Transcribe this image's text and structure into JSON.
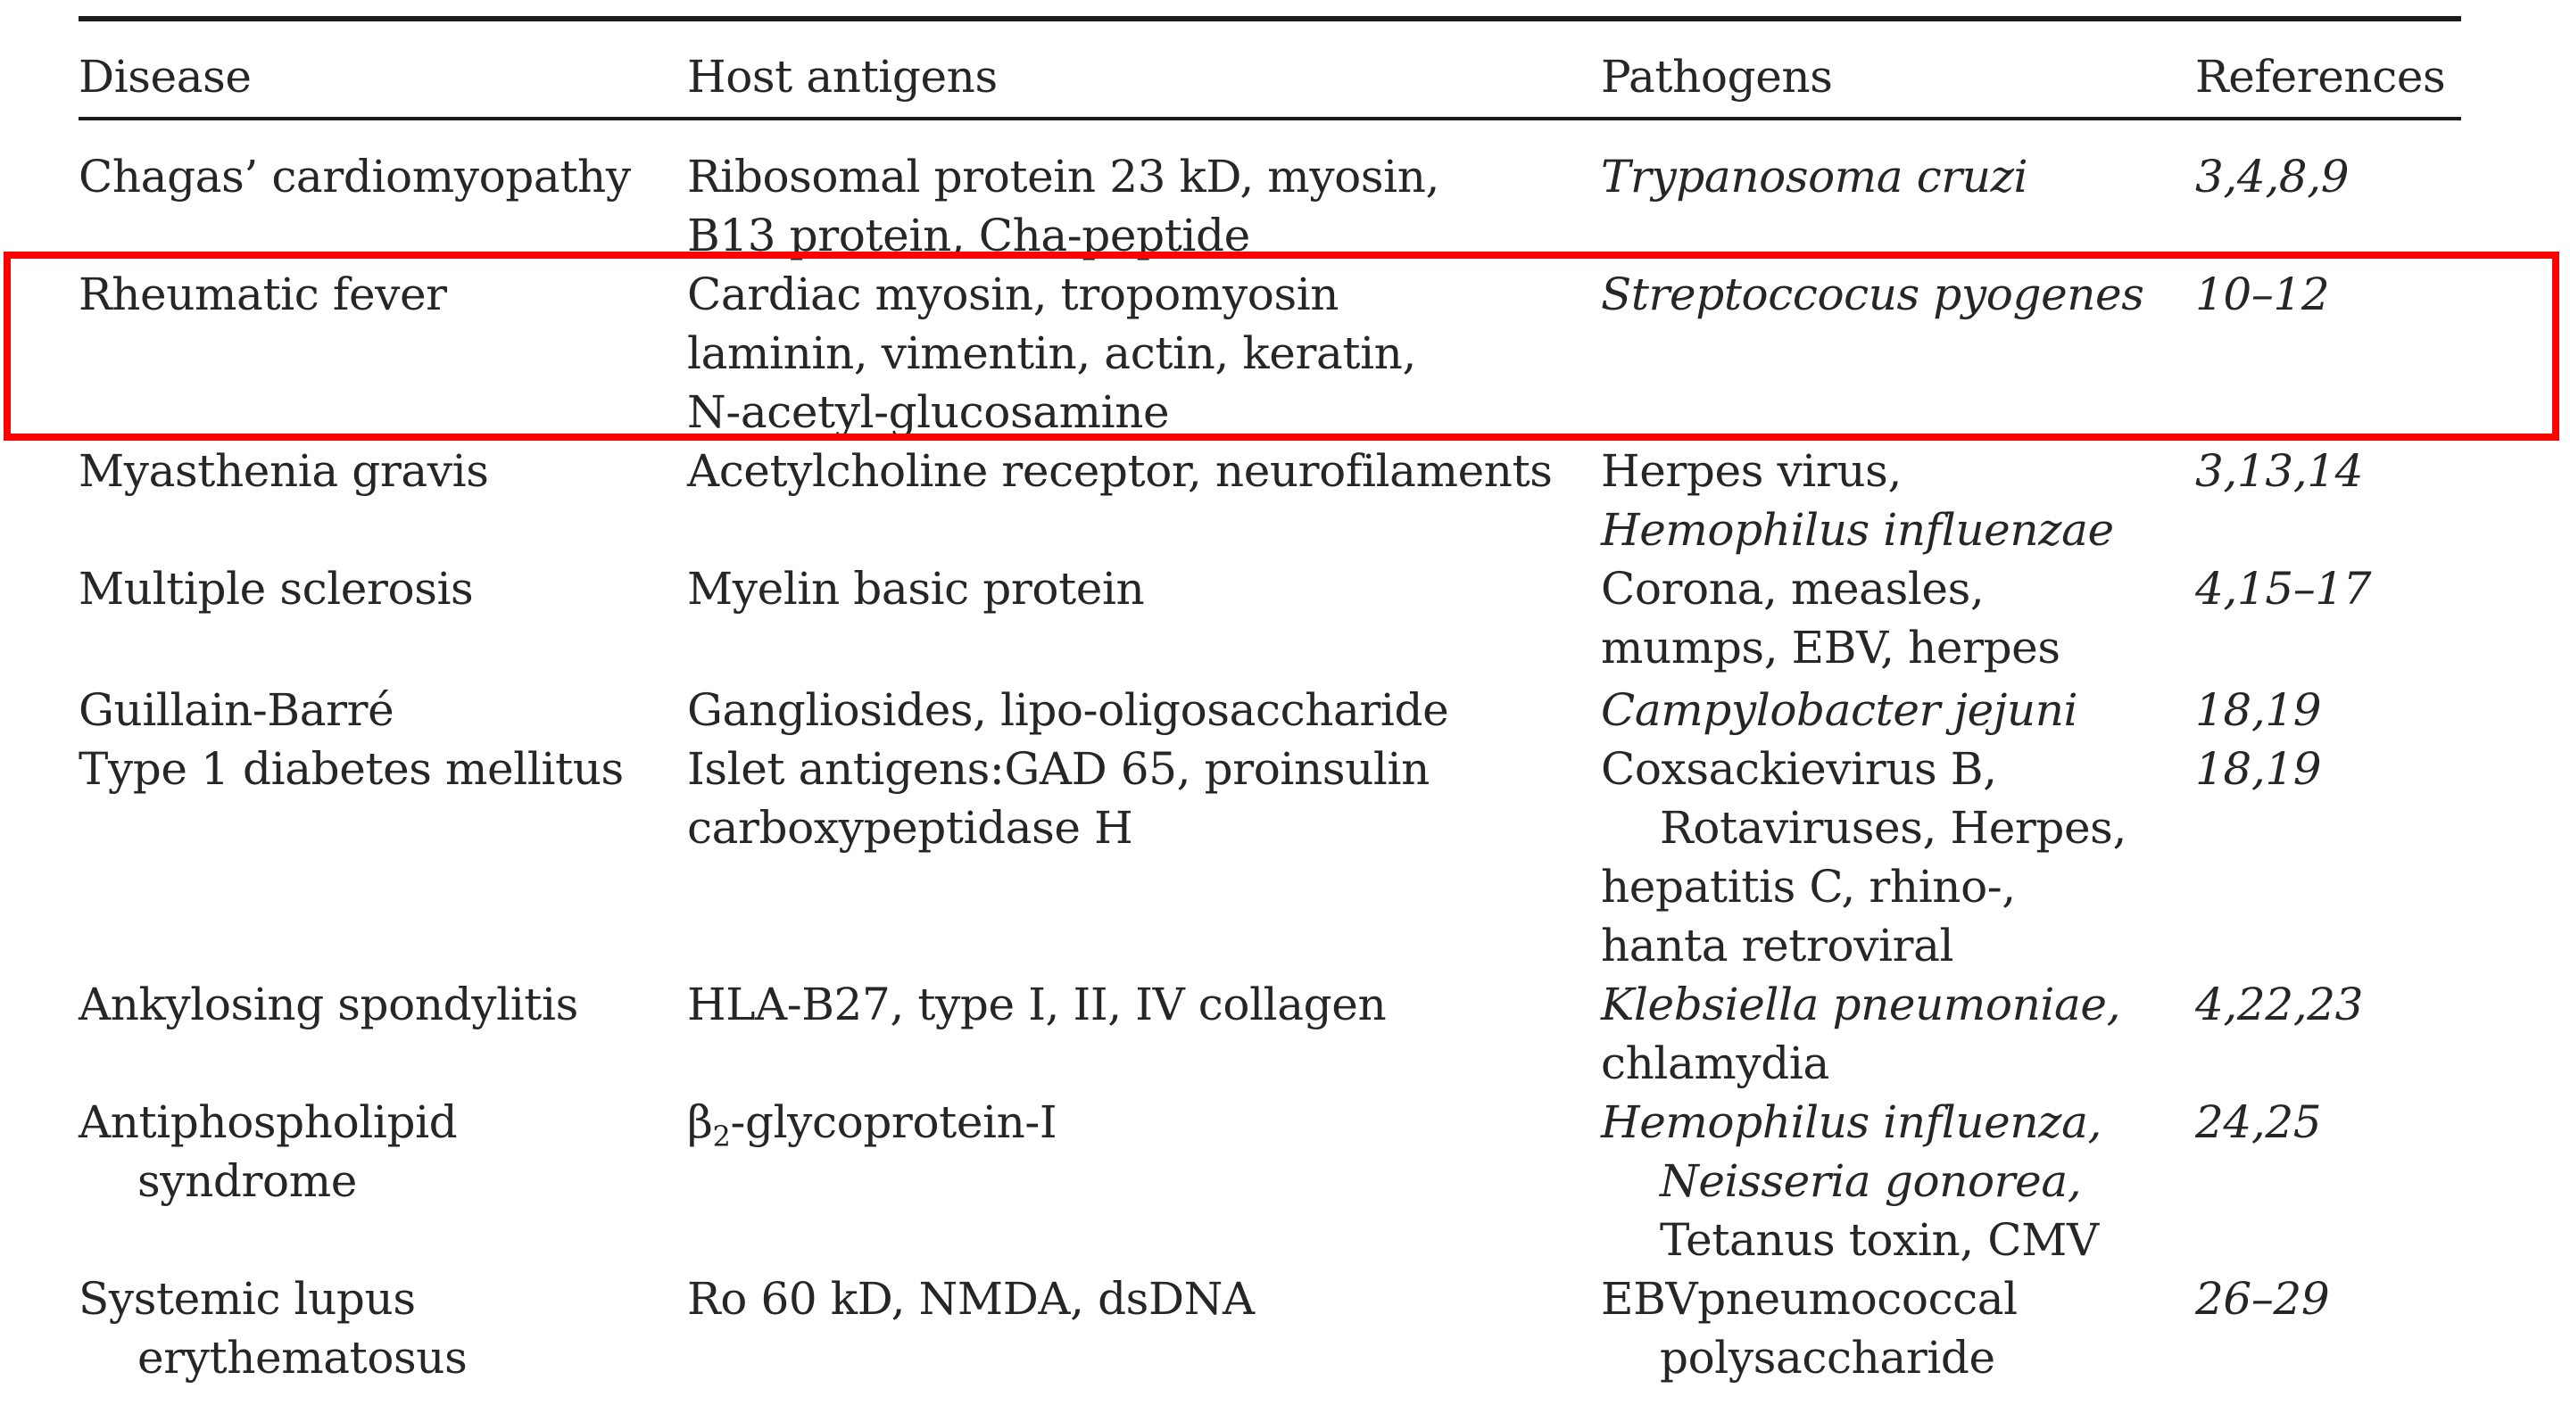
{
  "table": {
    "headers": {
      "disease": "Disease",
      "antigens": "Host antigens",
      "pathogens": "Pathogens",
      "refs": "References"
    },
    "rows": [
      {
        "disease": [
          "Chagas’ cardiomyopathy"
        ],
        "antigens": [
          "Ribosomal protein 23 kD, myosin,",
          "B13 protein, Cha-peptide"
        ],
        "pathogens": [
          "Trypanosoma cruzi"
        ],
        "refs": "3,4,8,9"
      },
      {
        "disease": [
          "Rheumatic fever"
        ],
        "antigens": [
          "Cardiac myosin, tropomyosin",
          "laminin, vimentin, actin, keratin,",
          "N-acetyl-glucosamine"
        ],
        "pathogens": [
          "Streptoccocus pyogenes"
        ],
        "refs": "10–12"
      },
      {
        "disease": [
          "Myasthenia gravis"
        ],
        "antigens": [
          "Acetylcholine receptor, neurofilaments"
        ],
        "pathogens": [
          "Herpes virus,",
          "Hemophilus influenzae"
        ],
        "refs": "3,13,14"
      },
      {
        "disease": [
          "Multiple sclerosis"
        ],
        "antigens": [
          "Myelin basic protein"
        ],
        "pathogens": [
          "Corona, measles,",
          "mumps, EBV, herpes"
        ],
        "refs": "4,15–17"
      },
      {
        "disease": [
          "Guillain-Barré"
        ],
        "antigens": [
          "Gangliosides, lipo-oligosaccharide"
        ],
        "pathogens": [
          "Campylobacter jejuni"
        ],
        "refs": "18,19"
      },
      {
        "disease": [
          "Type 1 diabetes mellitus"
        ],
        "antigens": [
          "Islet antigens:GAD 65, proinsulin",
          "carboxypeptidase H"
        ],
        "pathogens": [
          "Coxsackievirus B,",
          "Rotaviruses, Herpes,",
          "hepatitis C, rhino-,",
          "hanta retroviral"
        ],
        "refs": "18,19"
      },
      {
        "disease": [
          "Ankylosing spondylitis"
        ],
        "antigens": [
          "HLA-B27, type I, II, IV collagen"
        ],
        "pathogens": [
          "Klebsiella pneumoniae,",
          "chlamydia"
        ],
        "refs": "4,22,23"
      },
      {
        "disease": [
          "Antiphospholipid",
          "syndrome"
        ],
        "antigens_prefix": "β",
        "antigens_sub": "2",
        "antigens": [
          "-glycoprotein-I"
        ],
        "pathogens": [
          "Hemophilus influenza,",
          "Neisseria gonorea,",
          "Tetanus toxin, CMV"
        ],
        "refs": "24,25"
      },
      {
        "disease": [
          "Systemic lupus",
          "erythematosus"
        ],
        "antigens": [
          "Ro 60 kD, NMDA, dsDNA"
        ],
        "pathogens": [
          "EBVpneumococcal",
          "polysaccharide"
        ],
        "refs": "26–29"
      }
    ]
  },
  "highlight": {
    "color": "#ff0000"
  }
}
